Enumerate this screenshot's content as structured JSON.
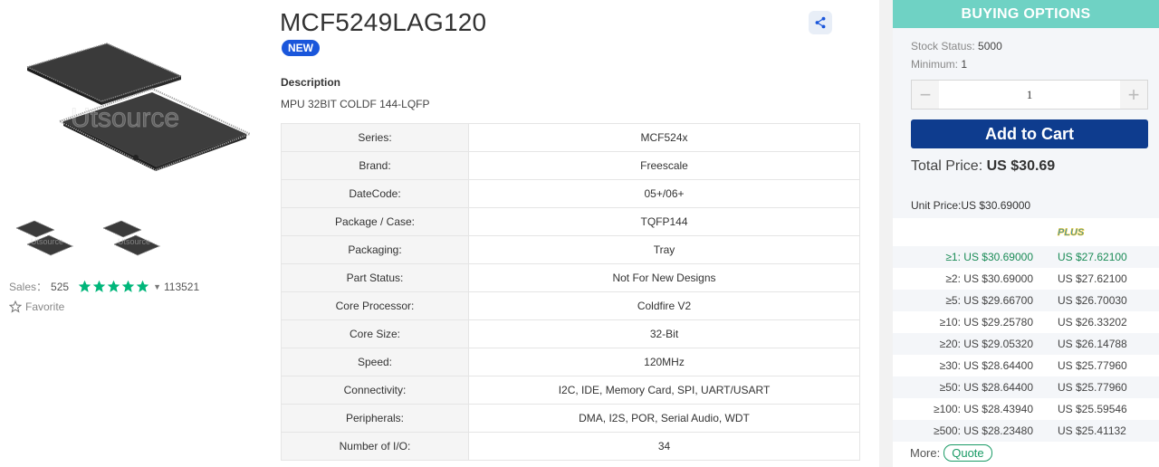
{
  "product": {
    "title": "MCF5249LAG120",
    "badge": "NEW",
    "description_label": "Description",
    "description": "MPU 32BIT COLDF 144-LQFP"
  },
  "gallery": {
    "watermark": "Utsource",
    "sales_label": "Sales：",
    "sales_count": "525",
    "rating": 5,
    "rating_count": "113521",
    "favorite_label": "Favorite"
  },
  "specs": [
    {
      "k": "Series:",
      "v": "MCF524x"
    },
    {
      "k": "Brand:",
      "v": "Freescale"
    },
    {
      "k": "DateCode:",
      "v": "05+/06+"
    },
    {
      "k": "Package / Case:",
      "v": "TQFP144"
    },
    {
      "k": "Packaging:",
      "v": "Tray"
    },
    {
      "k": "Part Status:",
      "v": "Not For New Designs"
    },
    {
      "k": "Core Processor:",
      "v": "Coldfire V2"
    },
    {
      "k": "Core Size:",
      "v": "32-Bit"
    },
    {
      "k": "Speed:",
      "v": "120MHz"
    },
    {
      "k": "Connectivity:",
      "v": "I2C, IDE, Memory Card, SPI, UART/USART"
    },
    {
      "k": "Peripherals:",
      "v": "DMA, I2S, POR, Serial Audio, WDT"
    },
    {
      "k": "Number of I/O:",
      "v": "34"
    }
  ],
  "buy": {
    "header": "BUYING OPTIONS",
    "stock_label": "Stock Status:",
    "stock_value": "5000",
    "min_label": "Minimum:",
    "min_value": "1",
    "quantity": "1",
    "add_to_cart": "Add to Cart",
    "total_label": "Total Price:",
    "total_value": "US $30.69",
    "unit_label": "Unit Price:",
    "unit_value": "US $30.69000",
    "plus_label": "PLUS",
    "tiers": [
      {
        "q": "≥1: US $30.69000",
        "p": "US $27.62100"
      },
      {
        "q": "≥2: US $30.69000",
        "p": "US $27.62100"
      },
      {
        "q": "≥5: US $29.66700",
        "p": "US $26.70030"
      },
      {
        "q": "≥10: US $29.25780",
        "p": "US $26.33202"
      },
      {
        "q": "≥20: US $29.05320",
        "p": "US $26.14788"
      },
      {
        "q": "≥30: US $28.64400",
        "p": "US $25.77960"
      },
      {
        "q": "≥50: US $28.64400",
        "p": "US $25.77960"
      },
      {
        "q": "≥100: US $28.43940",
        "p": "US $25.59546"
      },
      {
        "q": "≥500: US $28.23480",
        "p": "US $25.41132"
      }
    ],
    "more_label": "More:",
    "quote_label": "Quote"
  },
  "colors": {
    "accent_blue": "#0e3c8e",
    "badge_blue": "#1a56db",
    "header_teal": "#6fd2c4",
    "price_green": "#1a8b56",
    "star_green": "#00b67a"
  },
  "icons": [
    "share-icon",
    "star-icon",
    "minus-icon",
    "plus-icon",
    "chip-image"
  ]
}
